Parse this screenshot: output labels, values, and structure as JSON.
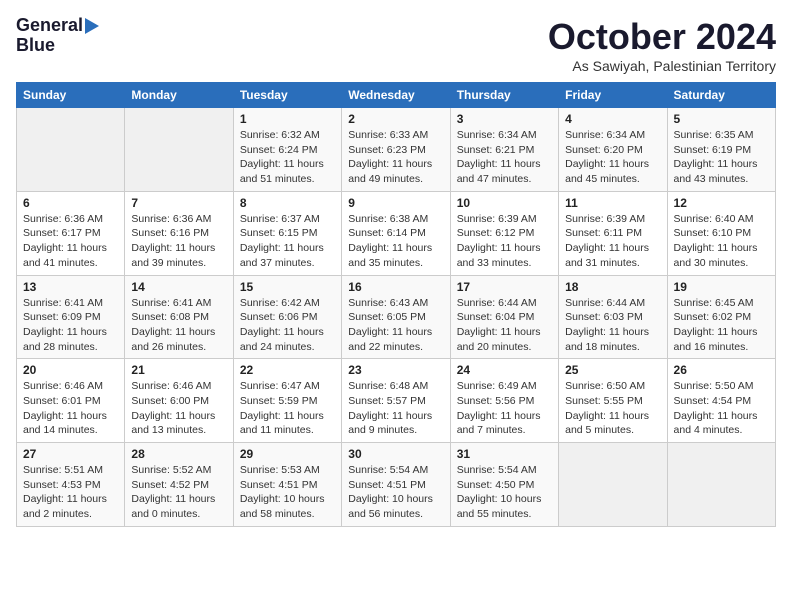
{
  "logo": {
    "line1": "General",
    "line2": "Blue"
  },
  "title": {
    "month_year": "October 2024",
    "location": "As Sawiyah, Palestinian Territory"
  },
  "headers": [
    "Sunday",
    "Monday",
    "Tuesday",
    "Wednesday",
    "Thursday",
    "Friday",
    "Saturday"
  ],
  "weeks": [
    [
      {
        "day": "",
        "sunrise": "",
        "sunset": "",
        "daylight": ""
      },
      {
        "day": "",
        "sunrise": "",
        "sunset": "",
        "daylight": ""
      },
      {
        "day": "1",
        "sunrise": "Sunrise: 6:32 AM",
        "sunset": "Sunset: 6:24 PM",
        "daylight": "Daylight: 11 hours and 51 minutes."
      },
      {
        "day": "2",
        "sunrise": "Sunrise: 6:33 AM",
        "sunset": "Sunset: 6:23 PM",
        "daylight": "Daylight: 11 hours and 49 minutes."
      },
      {
        "day": "3",
        "sunrise": "Sunrise: 6:34 AM",
        "sunset": "Sunset: 6:21 PM",
        "daylight": "Daylight: 11 hours and 47 minutes."
      },
      {
        "day": "4",
        "sunrise": "Sunrise: 6:34 AM",
        "sunset": "Sunset: 6:20 PM",
        "daylight": "Daylight: 11 hours and 45 minutes."
      },
      {
        "day": "5",
        "sunrise": "Sunrise: 6:35 AM",
        "sunset": "Sunset: 6:19 PM",
        "daylight": "Daylight: 11 hours and 43 minutes."
      }
    ],
    [
      {
        "day": "6",
        "sunrise": "Sunrise: 6:36 AM",
        "sunset": "Sunset: 6:17 PM",
        "daylight": "Daylight: 11 hours and 41 minutes."
      },
      {
        "day": "7",
        "sunrise": "Sunrise: 6:36 AM",
        "sunset": "Sunset: 6:16 PM",
        "daylight": "Daylight: 11 hours and 39 minutes."
      },
      {
        "day": "8",
        "sunrise": "Sunrise: 6:37 AM",
        "sunset": "Sunset: 6:15 PM",
        "daylight": "Daylight: 11 hours and 37 minutes."
      },
      {
        "day": "9",
        "sunrise": "Sunrise: 6:38 AM",
        "sunset": "Sunset: 6:14 PM",
        "daylight": "Daylight: 11 hours and 35 minutes."
      },
      {
        "day": "10",
        "sunrise": "Sunrise: 6:39 AM",
        "sunset": "Sunset: 6:12 PM",
        "daylight": "Daylight: 11 hours and 33 minutes."
      },
      {
        "day": "11",
        "sunrise": "Sunrise: 6:39 AM",
        "sunset": "Sunset: 6:11 PM",
        "daylight": "Daylight: 11 hours and 31 minutes."
      },
      {
        "day": "12",
        "sunrise": "Sunrise: 6:40 AM",
        "sunset": "Sunset: 6:10 PM",
        "daylight": "Daylight: 11 hours and 30 minutes."
      }
    ],
    [
      {
        "day": "13",
        "sunrise": "Sunrise: 6:41 AM",
        "sunset": "Sunset: 6:09 PM",
        "daylight": "Daylight: 11 hours and 28 minutes."
      },
      {
        "day": "14",
        "sunrise": "Sunrise: 6:41 AM",
        "sunset": "Sunset: 6:08 PM",
        "daylight": "Daylight: 11 hours and 26 minutes."
      },
      {
        "day": "15",
        "sunrise": "Sunrise: 6:42 AM",
        "sunset": "Sunset: 6:06 PM",
        "daylight": "Daylight: 11 hours and 24 minutes."
      },
      {
        "day": "16",
        "sunrise": "Sunrise: 6:43 AM",
        "sunset": "Sunset: 6:05 PM",
        "daylight": "Daylight: 11 hours and 22 minutes."
      },
      {
        "day": "17",
        "sunrise": "Sunrise: 6:44 AM",
        "sunset": "Sunset: 6:04 PM",
        "daylight": "Daylight: 11 hours and 20 minutes."
      },
      {
        "day": "18",
        "sunrise": "Sunrise: 6:44 AM",
        "sunset": "Sunset: 6:03 PM",
        "daylight": "Daylight: 11 hours and 18 minutes."
      },
      {
        "day": "19",
        "sunrise": "Sunrise: 6:45 AM",
        "sunset": "Sunset: 6:02 PM",
        "daylight": "Daylight: 11 hours and 16 minutes."
      }
    ],
    [
      {
        "day": "20",
        "sunrise": "Sunrise: 6:46 AM",
        "sunset": "Sunset: 6:01 PM",
        "daylight": "Daylight: 11 hours and 14 minutes."
      },
      {
        "day": "21",
        "sunrise": "Sunrise: 6:46 AM",
        "sunset": "Sunset: 6:00 PM",
        "daylight": "Daylight: 11 hours and 13 minutes."
      },
      {
        "day": "22",
        "sunrise": "Sunrise: 6:47 AM",
        "sunset": "Sunset: 5:59 PM",
        "daylight": "Daylight: 11 hours and 11 minutes."
      },
      {
        "day": "23",
        "sunrise": "Sunrise: 6:48 AM",
        "sunset": "Sunset: 5:57 PM",
        "daylight": "Daylight: 11 hours and 9 minutes."
      },
      {
        "day": "24",
        "sunrise": "Sunrise: 6:49 AM",
        "sunset": "Sunset: 5:56 PM",
        "daylight": "Daylight: 11 hours and 7 minutes."
      },
      {
        "day": "25",
        "sunrise": "Sunrise: 6:50 AM",
        "sunset": "Sunset: 5:55 PM",
        "daylight": "Daylight: 11 hours and 5 minutes."
      },
      {
        "day": "26",
        "sunrise": "Sunrise: 5:50 AM",
        "sunset": "Sunset: 4:54 PM",
        "daylight": "Daylight: 11 hours and 4 minutes."
      }
    ],
    [
      {
        "day": "27",
        "sunrise": "Sunrise: 5:51 AM",
        "sunset": "Sunset: 4:53 PM",
        "daylight": "Daylight: 11 hours and 2 minutes."
      },
      {
        "day": "28",
        "sunrise": "Sunrise: 5:52 AM",
        "sunset": "Sunset: 4:52 PM",
        "daylight": "Daylight: 11 hours and 0 minutes."
      },
      {
        "day": "29",
        "sunrise": "Sunrise: 5:53 AM",
        "sunset": "Sunset: 4:51 PM",
        "daylight": "Daylight: 10 hours and 58 minutes."
      },
      {
        "day": "30",
        "sunrise": "Sunrise: 5:54 AM",
        "sunset": "Sunset: 4:51 PM",
        "daylight": "Daylight: 10 hours and 56 minutes."
      },
      {
        "day": "31",
        "sunrise": "Sunrise: 5:54 AM",
        "sunset": "Sunset: 4:50 PM",
        "daylight": "Daylight: 10 hours and 55 minutes."
      },
      {
        "day": "",
        "sunrise": "",
        "sunset": "",
        "daylight": ""
      },
      {
        "day": "",
        "sunrise": "",
        "sunset": "",
        "daylight": ""
      }
    ]
  ]
}
